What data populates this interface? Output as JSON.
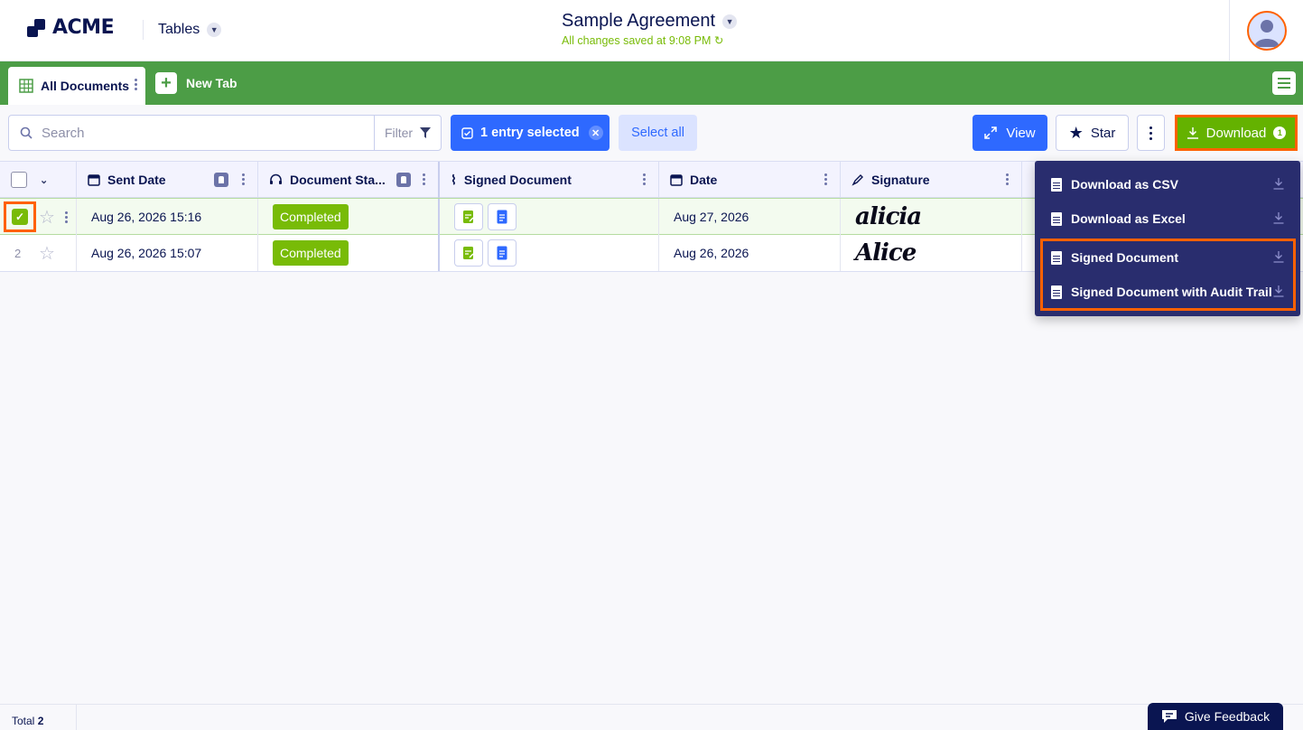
{
  "header": {
    "brand": "ACME",
    "app_name": "Tables",
    "doc_title": "Sample Agreement",
    "save_status": "All changes saved at 9:08 PM"
  },
  "tabs": {
    "active_label": "All Documents",
    "new_tab_label": "New Tab"
  },
  "toolbar": {
    "search_placeholder": "Search",
    "filter_label": "Filter",
    "selected_label": "1 entry selected",
    "select_all_label": "Select all",
    "view_label": "View",
    "star_label": "Star",
    "download_label": "Download",
    "download_badge": "1"
  },
  "columns": [
    {
      "label": "Sent Date",
      "icon": "calendar-icon"
    },
    {
      "label": "Document Sta...",
      "icon": "headset-icon"
    },
    {
      "label": "Signed Document",
      "icon": "paperclip-icon"
    },
    {
      "label": "Date",
      "icon": "calendar-icon"
    },
    {
      "label": "Signature",
      "icon": "pen-icon"
    }
  ],
  "rows": [
    {
      "num": "",
      "sent_date": "Aug 26, 2026 15:16",
      "status": "Completed",
      "date": "Aug 27, 2026",
      "signature": "alicia",
      "selected": true
    },
    {
      "num": "2",
      "sent_date": "Aug 26, 2026 15:07",
      "status": "Completed",
      "date": "Aug 26, 2026",
      "signature": "Alice",
      "selected": false
    }
  ],
  "download_menu": {
    "items": [
      {
        "label": "Download as CSV",
        "icon": "csv-file-icon"
      },
      {
        "label": "Download as Excel",
        "icon": "xlsx-file-icon"
      },
      {
        "label": "Signed Document",
        "icon": "document-icon"
      },
      {
        "label": "Signed Document with Audit Trail",
        "icon": "document-icon"
      }
    ]
  },
  "footer": {
    "total_label": "Total",
    "total_count": "2",
    "feedback_label": "Give Feedback"
  },
  "colors": {
    "brand_navy": "#0a1551",
    "tab_green": "#4c9d46",
    "status_green": "#78bb07",
    "accent_blue": "#2e69ff",
    "highlight_orange": "#ff6100",
    "menu_bg": "#292d6e"
  }
}
